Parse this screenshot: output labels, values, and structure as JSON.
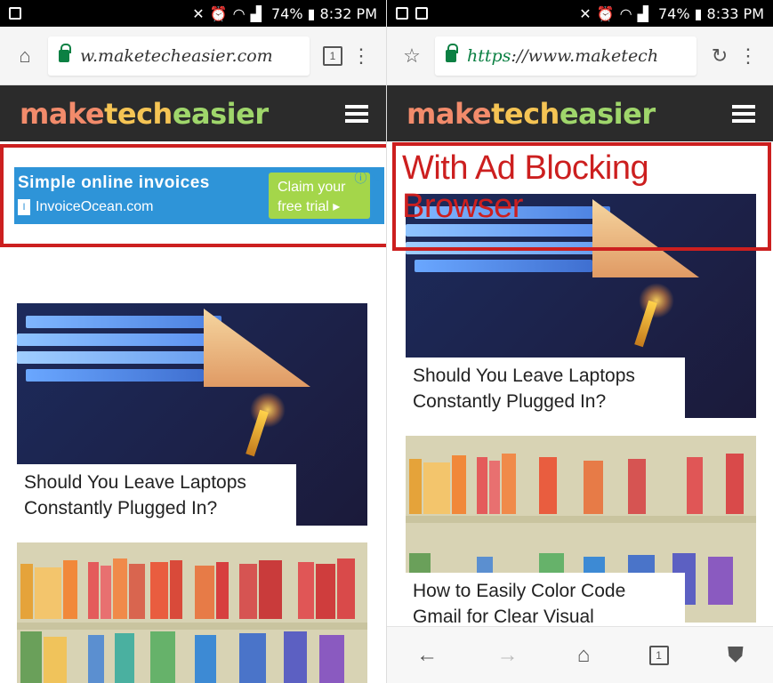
{
  "left": {
    "status": {
      "left_icons": [
        "screen-icon"
      ],
      "right": " 74% ▮ 8:32 PM"
    },
    "chrome": {
      "url": "w.maketecheasier.com",
      "tab_count": "1"
    },
    "site": {
      "logo_a": "make",
      "logo_b": "tech",
      "logo_c": "easier"
    },
    "ad": {
      "title": "Simple online invoices",
      "sub": "InvoiceOcean.com",
      "cta": "Claim your free trial ▸"
    },
    "articles": [
      {
        "title": "Should You Leave Laptops Constantly Plugged In?"
      }
    ]
  },
  "right": {
    "status": {
      "right": " 74% ▮ 8:33 PM"
    },
    "chrome": {
      "url_scheme": "https",
      "url_rest": "://www.maketech"
    },
    "site": {
      "logo_a": "make",
      "logo_b": "tech",
      "logo_c": "easier"
    },
    "label": "With Ad Blocking Browser",
    "articles": [
      {
        "title": "Should You Leave Laptops Constantly Plugged In?"
      },
      {
        "title": "How to Easily Color Code Gmail for Clear Visual"
      }
    ],
    "tab_count": "1"
  },
  "colors": {
    "highlight": "#cc1f1f",
    "ad_blue": "#2e94d8",
    "ad_green": "#a4d64a",
    "header_bg": "#2b2b2b"
  }
}
